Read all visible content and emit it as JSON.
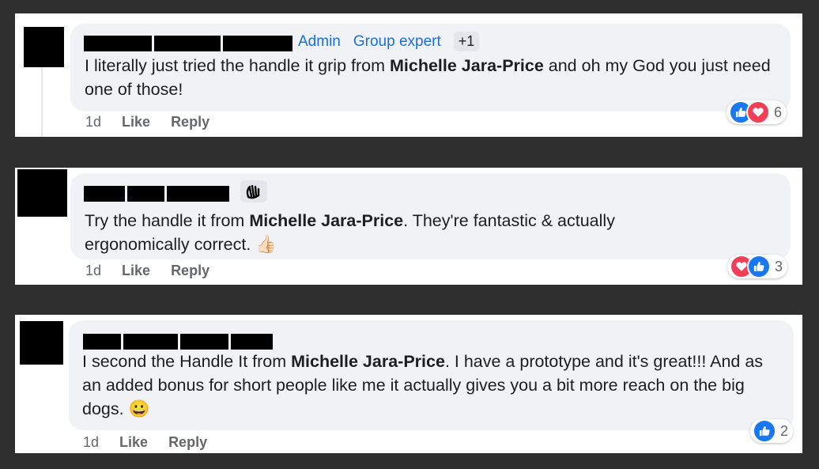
{
  "comments": [
    {
      "badges": {
        "admin": "Admin",
        "expert": "Group expert",
        "more": "+1"
      },
      "text_before": "I literally just tried the handle it grip from ",
      "mention": "Michelle Jara-Price",
      "text_after": " and oh my God you just need one of those!",
      "timestamp": "1d",
      "like_label": "Like",
      "reply_label": "Reply",
      "reaction_count": "6",
      "reactions": [
        "like-icon",
        "love-icon"
      ]
    },
    {
      "badge_icon": "waving-hand-icon",
      "text_before": "Try the handle it from ",
      "mention": "Michelle Jara-Price",
      "text_after": ". They're fantastic & actually ergonomically correct. ",
      "emoji": "👍🏻",
      "timestamp": "1d",
      "like_label": "Like",
      "reply_label": "Reply",
      "reaction_count": "3",
      "reactions": [
        "love-icon",
        "like-icon"
      ]
    },
    {
      "text_before": "I second the Handle It from ",
      "mention": "Michelle Jara-Price",
      "text_after": ". I have a prototype and it's great!!! And as an added bonus for short people like me it actually gives you a bit more reach on the big dogs. ",
      "emoji": "😀",
      "timestamp": "1d",
      "like_label": "Like",
      "reply_label": "Reply",
      "reaction_count": "2",
      "reactions": [
        "like-icon"
      ]
    }
  ],
  "colors": {
    "like": "#1877f2",
    "love": "#f33e58",
    "badge_link": "#1a6ed8"
  }
}
